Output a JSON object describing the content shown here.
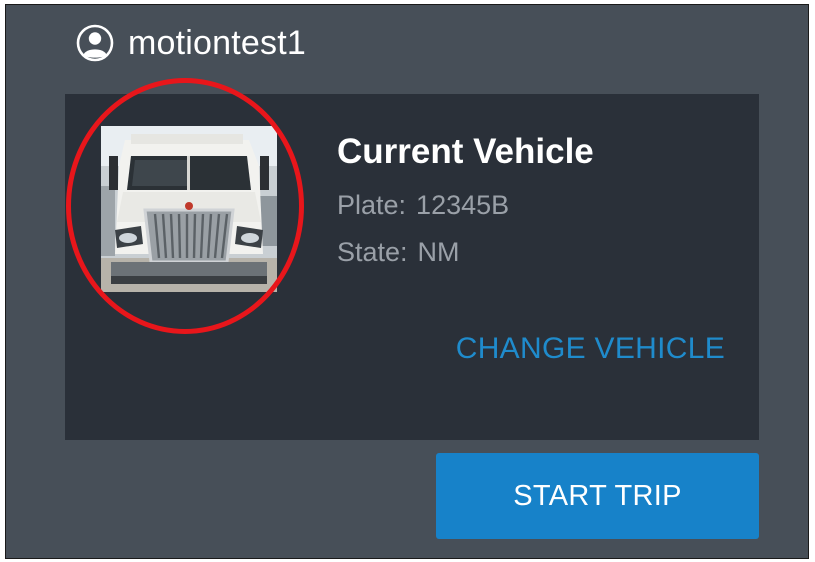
{
  "header": {
    "user_icon": "user-circle-icon",
    "username": "motiontest1"
  },
  "vehicle": {
    "title": "Current Vehicle",
    "plate_label": "Plate:",
    "plate_value": "12345B",
    "state_label": "State:",
    "state_value": "NM",
    "photo": "truck-photo",
    "change_label": "CHANGE VEHICLE"
  },
  "actions": {
    "start_trip_label": "START TRIP"
  },
  "colors": {
    "background": "#474f58",
    "card": "#2a3039",
    "accent": "#1782c9",
    "link": "#1f8bcc",
    "highlight": "#e8161b"
  }
}
